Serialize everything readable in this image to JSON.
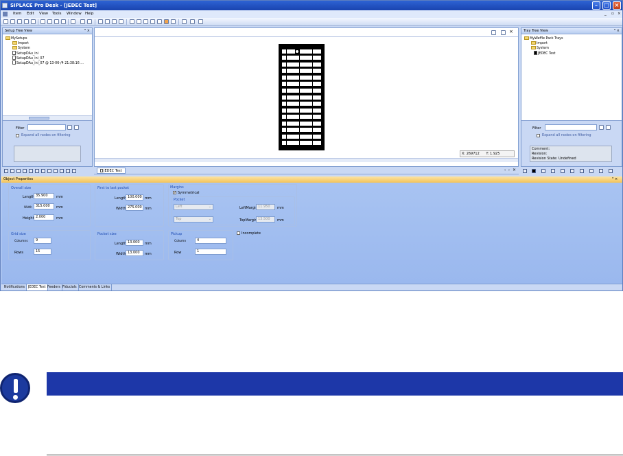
{
  "window": {
    "title": "SIPLACE Pro Desk - [JEDEC Test]"
  },
  "menu": [
    "Item",
    "Edit",
    "View",
    "Tools",
    "Window",
    "Help"
  ],
  "setup_tree": {
    "title": "Setup Tree View",
    "items": [
      {
        "label": "MySetups",
        "icon": "folder-icon"
      },
      {
        "label": "Import",
        "icon": "folder-icon"
      },
      {
        "label": "System",
        "icon": "folder-icon"
      },
      {
        "label": "SetupDAu_ini",
        "icon": "document-icon"
      },
      {
        "label": "SetupDAu_ini_07",
        "icon": "document-icon"
      },
      {
        "label": "SetupDAu_ini_07 @ 13-06-/4 21:38:16 ...",
        "icon": "document-icon"
      }
    ],
    "filter_label": "Filter",
    "expand_label": "Expand all nodes on filtering"
  },
  "tray_tree": {
    "title": "Tray Tree View",
    "items": [
      {
        "label": "MyWaffle Pack Trays",
        "icon": "folder-icon"
      },
      {
        "label": "Import",
        "icon": "folder-icon"
      },
      {
        "label": "System",
        "icon": "folder-icon"
      },
      {
        "label": "JEDEC Test",
        "icon": "tray-icon"
      }
    ],
    "filter_label": "Filter",
    "expand_label": "Expand all nodes on filtering",
    "comment_label": "Comment:",
    "revision_label": "Revision:",
    "revision_state": "Revision State: Undefined"
  },
  "canvas": {
    "coord_x": "X: 269712",
    "coord_y": "Y: 1.925",
    "tab": "JEDEC Test",
    "tray": {
      "columns": 9,
      "rows": 15,
      "pickup_column": 4,
      "pickup_row": 1
    }
  },
  "properties": {
    "title": "Object Properties",
    "overall": {
      "title": "Overall size",
      "length_label": "Length",
      "length": "35.900",
      "width_label": "Width",
      "width": "315.000",
      "height_label": "Height",
      "height": "2.000",
      "unit": "mm"
    },
    "first_last": {
      "title": "First to last pocket",
      "length_label": "Length",
      "length": "100.000",
      "width_label": "Width",
      "width": "275.000",
      "unit": "mm"
    },
    "margins": {
      "title": "Margins",
      "symmetrical_label": "Symmetrical",
      "symmetrical": true,
      "pocket_label": "Pocket",
      "left_select": "Left",
      "top_select": "Top",
      "left_margin_label": "LeftMargin",
      "left_margin": "11.950",
      "top_margin_label": "TopMargin",
      "top_margin": "13.500",
      "unit": "mm"
    },
    "grid": {
      "title": "Grid size",
      "columns_label": "Columns",
      "columns": "9",
      "rows_label": "Rows",
      "rows": "15"
    },
    "pocket_size": {
      "title": "Pocket size",
      "length_label": "Length",
      "length": "13.000",
      "width_label": "Width",
      "width": "13.000",
      "unit": "mm"
    },
    "pickup": {
      "title": "Pickup",
      "column_label": "Column",
      "column": "4",
      "row_label": "Row",
      "row": "1"
    },
    "incomplete_label": "Incomplete"
  },
  "bottom_tabs": [
    "Notifications",
    "JEDEC Test",
    "Feeders",
    "Fiducials",
    "Comments & Links"
  ],
  "colors": {
    "notice_bar": "#1d37a8",
    "title_bar": "#1a45b0",
    "props_bg": "#9ab8ee"
  }
}
